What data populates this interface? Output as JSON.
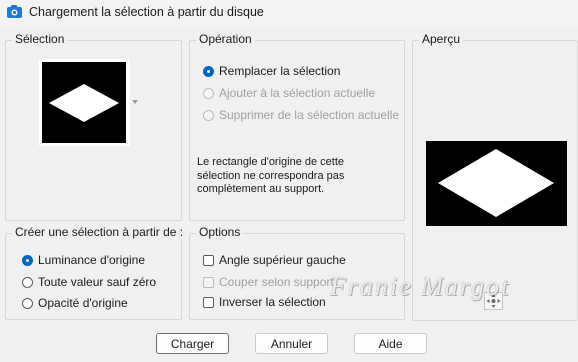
{
  "window": {
    "title": "Chargement la sélection à partir du disque"
  },
  "selection": {
    "label": "Sélection"
  },
  "operation": {
    "label": "Opération",
    "options": [
      {
        "label": "Remplacer la sélection",
        "checked": true,
        "enabled": true
      },
      {
        "label": "Ajouter à la sélection actuelle",
        "checked": false,
        "enabled": false
      },
      {
        "label": "Supprimer de la sélection actuelle",
        "checked": false,
        "enabled": false
      }
    ],
    "note": "Le rectangle d'origine de cette sélection ne correspondra pas complètement au support."
  },
  "preview": {
    "label": "Aperçu"
  },
  "create": {
    "label": "Créer une sélection à partir de :",
    "options": [
      {
        "label": "Luminance d'origine",
        "checked": true
      },
      {
        "label": "Toute valeur sauf zéro",
        "checked": false
      },
      {
        "label": "Opacité d'origine",
        "checked": false
      }
    ]
  },
  "options": {
    "label": "Options",
    "items": [
      {
        "label": "Angle supérieur gauche",
        "checked": false,
        "enabled": true
      },
      {
        "label": "Couper selon support",
        "checked": false,
        "enabled": false
      },
      {
        "label": "Inverser la sélection",
        "checked": false,
        "enabled": true
      }
    ]
  },
  "buttons": {
    "load": "Charger",
    "cancel": "Annuler",
    "help": "Aide"
  },
  "watermark": "Franie Margot",
  "colors": {
    "accent": "#0067c0",
    "background": "#f0f0f0",
    "preview_bg": "#000000"
  }
}
